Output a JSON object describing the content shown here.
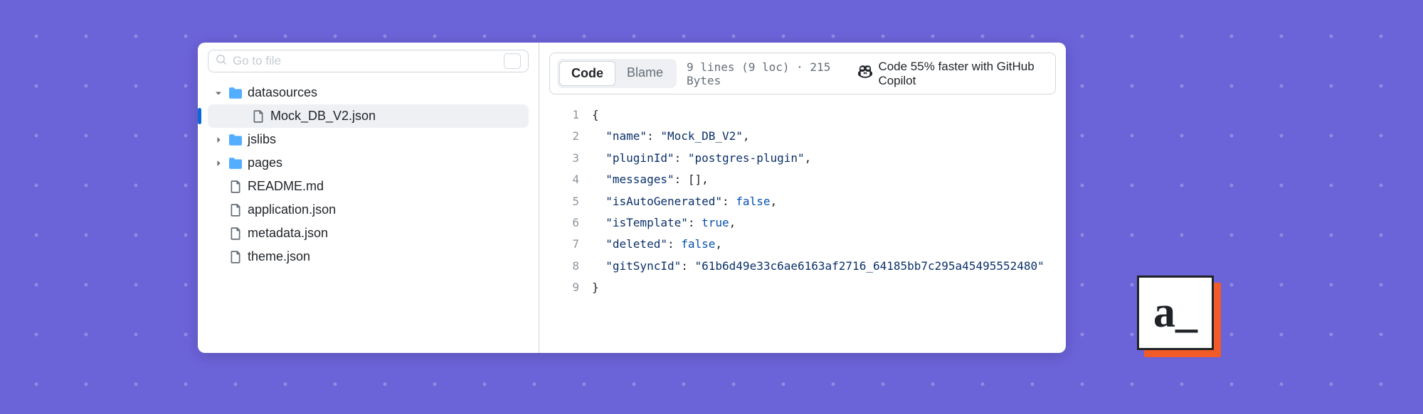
{
  "sidebar": {
    "search_placeholder": "Go to file",
    "items": [
      {
        "label": "datasources",
        "type": "folder",
        "expanded": true,
        "indent": 0
      },
      {
        "label": "Mock_DB_V2.json",
        "type": "file",
        "selected": true,
        "indent": 1
      },
      {
        "label": "jslibs",
        "type": "folder",
        "expanded": false,
        "indent": 0
      },
      {
        "label": "pages",
        "type": "folder",
        "expanded": false,
        "indent": 0
      },
      {
        "label": "README.md",
        "type": "file",
        "indent": 0
      },
      {
        "label": "application.json",
        "type": "file",
        "indent": 0
      },
      {
        "label": "metadata.json",
        "type": "file",
        "indent": 0
      },
      {
        "label": "theme.json",
        "type": "file",
        "indent": 0
      }
    ]
  },
  "toolbar": {
    "tabs": {
      "code": "Code",
      "blame": "Blame"
    },
    "meta": "9 lines (9 loc) · 215 Bytes",
    "copilot_promo": "Code 55% faster with GitHub Copilot"
  },
  "code": {
    "lines": [
      {
        "n": "1",
        "html": "<span class='tok-punct'>{</span>"
      },
      {
        "n": "2",
        "html": "  <span class='tok-key'>\"name\"</span><span class='tok-punct'>: </span><span class='tok-str'>\"Mock_DB_V2\"</span><span class='tok-punct'>,</span>"
      },
      {
        "n": "3",
        "html": "  <span class='tok-key'>\"pluginId\"</span><span class='tok-punct'>: </span><span class='tok-str'>\"postgres-plugin\"</span><span class='tok-punct'>,</span>"
      },
      {
        "n": "4",
        "html": "  <span class='tok-key'>\"messages\"</span><span class='tok-punct'>: [],</span>"
      },
      {
        "n": "5",
        "html": "  <span class='tok-key'>\"isAutoGenerated\"</span><span class='tok-punct'>: </span><span class='tok-bool'>false</span><span class='tok-punct'>,</span>"
      },
      {
        "n": "6",
        "html": "  <span class='tok-key'>\"isTemplate\"</span><span class='tok-punct'>: </span><span class='tok-bool'>true</span><span class='tok-punct'>,</span>"
      },
      {
        "n": "7",
        "html": "  <span class='tok-key'>\"deleted\"</span><span class='tok-punct'>: </span><span class='tok-bool'>false</span><span class='tok-punct'>,</span>"
      },
      {
        "n": "8",
        "html": "  <span class='tok-key'>\"gitSyncId\"</span><span class='tok-punct'>: </span><span class='tok-str'>\"61b6d49e33c6ae6163af2716_64185bb7c295a45495552480\"</span>"
      },
      {
        "n": "9",
        "html": "<span class='tok-punct'>}</span>"
      }
    ]
  },
  "logo": {
    "text": "a_"
  }
}
